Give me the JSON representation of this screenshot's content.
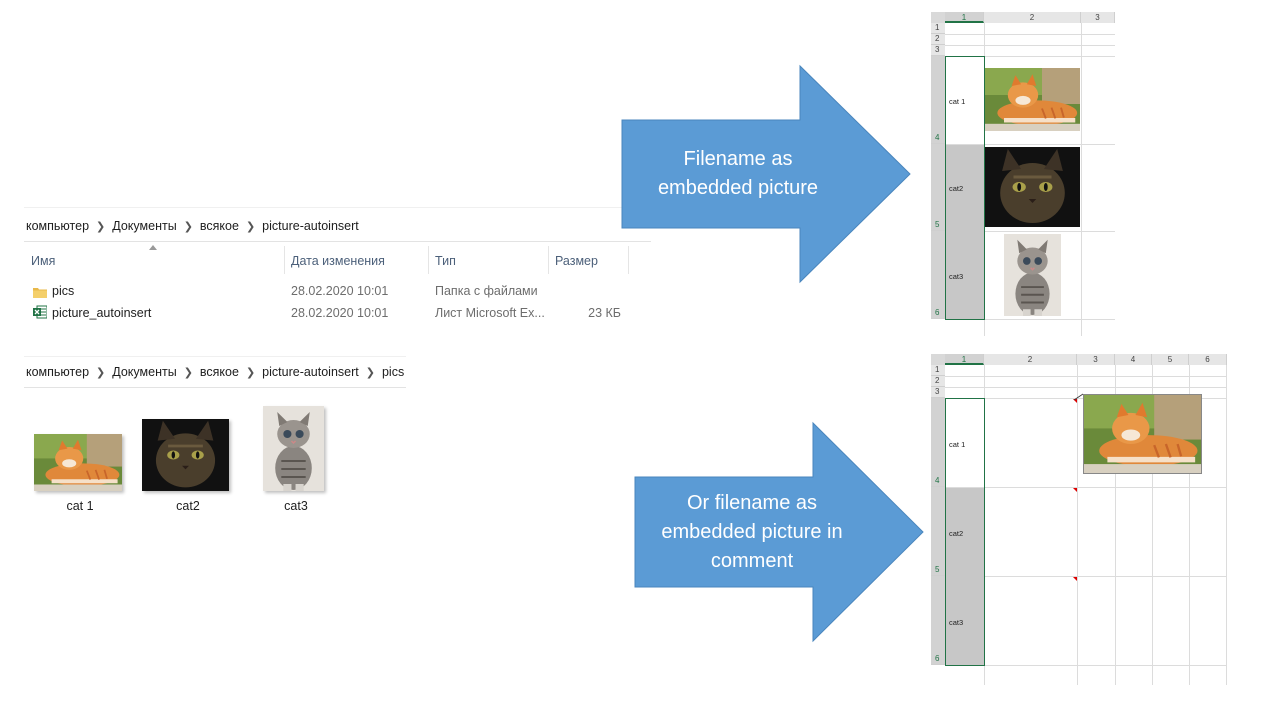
{
  "explorer_top": {
    "breadcrumb": [
      "компьютер",
      "Документы",
      "всякое",
      "picture-autoinsert"
    ],
    "columns": [
      "Имя",
      "Дата изменения",
      "Тип",
      "Размер"
    ],
    "rows": [
      {
        "name": "pics",
        "date": "28.02.2020 10:01",
        "type": "Папка с файлами",
        "size": "",
        "icon": "folder-icon"
      },
      {
        "name": "picture_autoinsert",
        "date": "28.02.2020 10:01",
        "type": "Лист Microsoft Ex...",
        "size": "23 КБ",
        "icon": "excel-file-icon"
      }
    ]
  },
  "explorer_bottom": {
    "breadcrumb": [
      "компьютер",
      "Документы",
      "всякое",
      "picture-autoinsert",
      "pics"
    ],
    "thumbnails": [
      {
        "caption": "cat 1"
      },
      {
        "caption": "cat2"
      },
      {
        "caption": "cat3"
      }
    ]
  },
  "arrow_top": {
    "line1": "Filename as",
    "line2": "embedded picture",
    "color": "#5b9bd5"
  },
  "arrow_bottom": {
    "line1": "Or filename as",
    "line2": "embedded picture in",
    "line3": "comment",
    "color": "#5b9bd5"
  },
  "sheet_top": {
    "col_headers": [
      "1",
      "2",
      "3"
    ],
    "row_headers": [
      "1",
      "2",
      "3",
      "4",
      "5",
      "6"
    ],
    "cells": [
      "cat 1",
      "cat2",
      "cat3"
    ]
  },
  "sheet_bottom": {
    "col_headers": [
      "1",
      "2",
      "3",
      "4",
      "5",
      "6"
    ],
    "row_headers": [
      "1",
      "2",
      "3",
      "4",
      "5",
      "6"
    ],
    "cells": [
      "cat 1",
      "cat2",
      "cat3"
    ]
  }
}
